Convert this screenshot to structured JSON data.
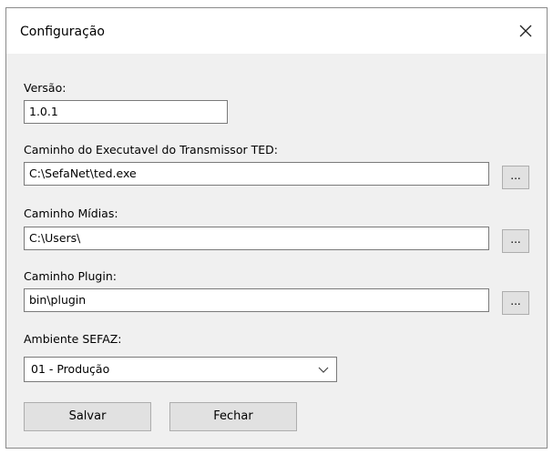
{
  "window": {
    "title": "Configuração",
    "close_glyph": "close-icon"
  },
  "form": {
    "versao": {
      "label": "Versão:",
      "value": "1.0.1"
    },
    "caminho_ted": {
      "label": "Caminho do Executavel do Transmissor TED:",
      "value": "C:\\SefaNet\\ted.exe",
      "browse_label": "..."
    },
    "caminho_midias": {
      "label": "Caminho Mídias:",
      "value": "C:\\Users\\",
      "browse_label": "..."
    },
    "caminho_plugin": {
      "label": "Caminho Plugin:",
      "value": "bin\\plugin",
      "browse_label": "..."
    },
    "ambiente": {
      "label": "Ambiente SEFAZ:",
      "selected": "01 - Produção"
    }
  },
  "buttons": {
    "salvar": "Salvar",
    "fechar": "Fechar"
  },
  "colors": {
    "dialog_bg": "#f0f0f0",
    "titlebar_bg": "#ffffff",
    "button_bg": "#e1e1e1",
    "input_border": "#7a7a7a"
  }
}
